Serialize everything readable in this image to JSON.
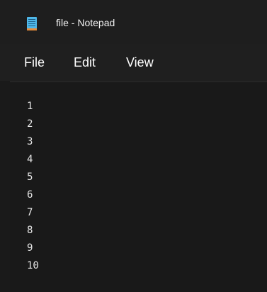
{
  "window": {
    "title": "file - Notepad",
    "icon": "notepad-icon"
  },
  "menu": {
    "items": [
      "File",
      "Edit",
      "View"
    ]
  },
  "editor": {
    "lines": [
      "1",
      "2",
      "3",
      "4",
      "5",
      "6",
      "7",
      "8",
      "9",
      "10"
    ]
  },
  "colors": {
    "background": "#1f1f1f",
    "editor_background": "#191919",
    "text": "#ffffff",
    "icon_blue": "#4fb7e8",
    "icon_orange": "#e58b3a"
  }
}
